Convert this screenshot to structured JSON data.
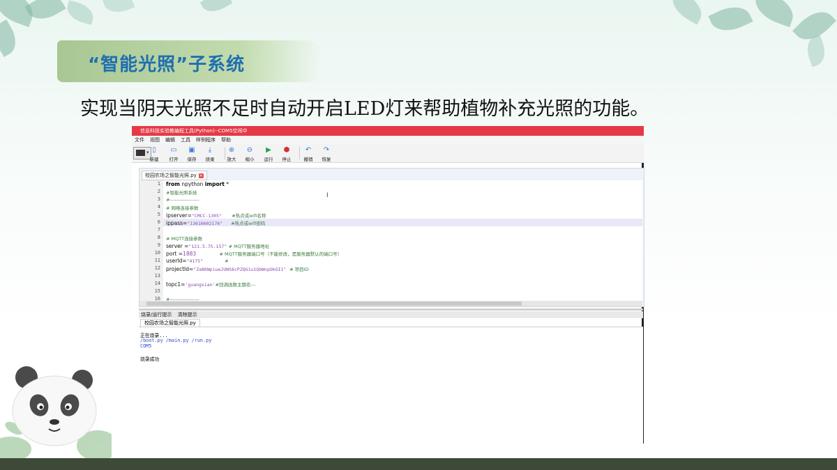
{
  "slide": {
    "title": "“智能光照”子系统",
    "subtitle": "实现当阴天光照不足时自动开启LED灯来帮助植物补充光照的功能。"
  },
  "ide": {
    "window_title": "信息科技实验教编程工具(Python)--COM5空闲中",
    "menu": [
      "文件",
      "视图",
      "编辑",
      "工具",
      "样例程序",
      "帮助"
    ],
    "toolbar": [
      {
        "label": "新建",
        "icon": "new-file-icon"
      },
      {
        "label": "打开",
        "icon": "open-folder-icon"
      },
      {
        "label": "保存",
        "icon": "save-icon"
      },
      {
        "label": "烧录",
        "icon": "download-icon"
      },
      {
        "label": "放大",
        "icon": "zoom-in-icon"
      },
      {
        "label": "缩小",
        "icon": "zoom-out-icon"
      },
      {
        "label": "运行",
        "icon": "run-icon"
      },
      {
        "label": "停止",
        "icon": "stop-icon"
      },
      {
        "label": "撤销",
        "icon": "undo-icon"
      },
      {
        "label": "恢复",
        "icon": "redo-icon"
      }
    ],
    "editor_tab": "校园农场之智能光照.py",
    "code_lines": [
      {
        "n": "1",
        "parts": [
          [
            "kw",
            "from"
          ],
          [
            "t",
            " npython "
          ],
          [
            "kw",
            "import"
          ],
          [
            "t",
            " *"
          ]
        ]
      },
      {
        "n": "2",
        "parts": [
          [
            "cm",
            "#智能光照系统"
          ]
        ]
      },
      {
        "n": "3",
        "parts": [
          [
            "cm",
            "#------------------"
          ]
        ]
      },
      {
        "n": "4",
        "parts": [
          [
            "cm",
            "# 网络连接参数"
          ]
        ]
      },
      {
        "n": "5",
        "parts": [
          [
            "t",
            "ipserver="
          ],
          [
            "st",
            "\"CMCC-1305\""
          ],
          [
            "t",
            "      "
          ],
          [
            "cm",
            "#热点或wifi名称"
          ]
        ]
      },
      {
        "n": "6",
        "parts": [
          [
            "t",
            "ippass="
          ],
          [
            "st",
            "\"13616602176\""
          ],
          [
            "t",
            "     "
          ],
          [
            "cm",
            "#热点或wifi密码"
          ]
        ]
      },
      {
        "n": "7",
        "parts": []
      },
      {
        "n": "8",
        "parts": [
          [
            "cm",
            "# MQTT连接参数"
          ]
        ]
      },
      {
        "n": "9",
        "parts": [
          [
            "t",
            "server ="
          ],
          [
            "st",
            "\"121.5.75.157\""
          ],
          [
            "t",
            " "
          ],
          [
            "cm",
            "# MQTT服务器地址"
          ]
        ]
      },
      {
        "n": "10",
        "parts": [
          [
            "t",
            "port ="
          ],
          [
            "num",
            "1883"
          ],
          [
            "t",
            "              "
          ],
          [
            "cm",
            "# MQTT服务器端口号（不能修改，是服务器默认的端口号）"
          ]
        ]
      },
      {
        "n": "11",
        "parts": [
          [
            "t",
            "userId="
          ],
          [
            "st",
            "\"4175\""
          ],
          [
            "t",
            "             "
          ],
          [
            "cm",
            "#"
          ]
        ]
      },
      {
        "n": "12",
        "parts": [
          [
            "t",
            "projectId="
          ],
          [
            "st",
            "\"Za8KWpiueJUNS6cPZQG1u1QbWnpOkGI1\""
          ],
          [
            "t",
            "  "
          ],
          [
            "cm",
            "# 项目ID"
          ]
        ]
      },
      {
        "n": "13",
        "parts": []
      },
      {
        "n": "14",
        "parts": [
          [
            "t",
            "topc1="
          ],
          [
            "st",
            "'guangxian'"
          ],
          [
            "cm",
            "#回调函数主题名---"
          ]
        ]
      },
      {
        "n": "15",
        "parts": []
      },
      {
        "n": "16",
        "parts": [
          [
            "cm",
            "#------------------"
          ]
        ]
      }
    ],
    "console_tabs": [
      "烧录/运行提示",
      "清除提示"
    ],
    "console_file": "校园农场之智能光照.py",
    "console_lines": [
      "正在烧录...",
      "/boot.py /main.py /run.py",
      "COM5",
      "",
      "烧录成功"
    ]
  },
  "colors": {
    "titlebar": "#e53a46",
    "title_text": "#1f6fb0"
  }
}
